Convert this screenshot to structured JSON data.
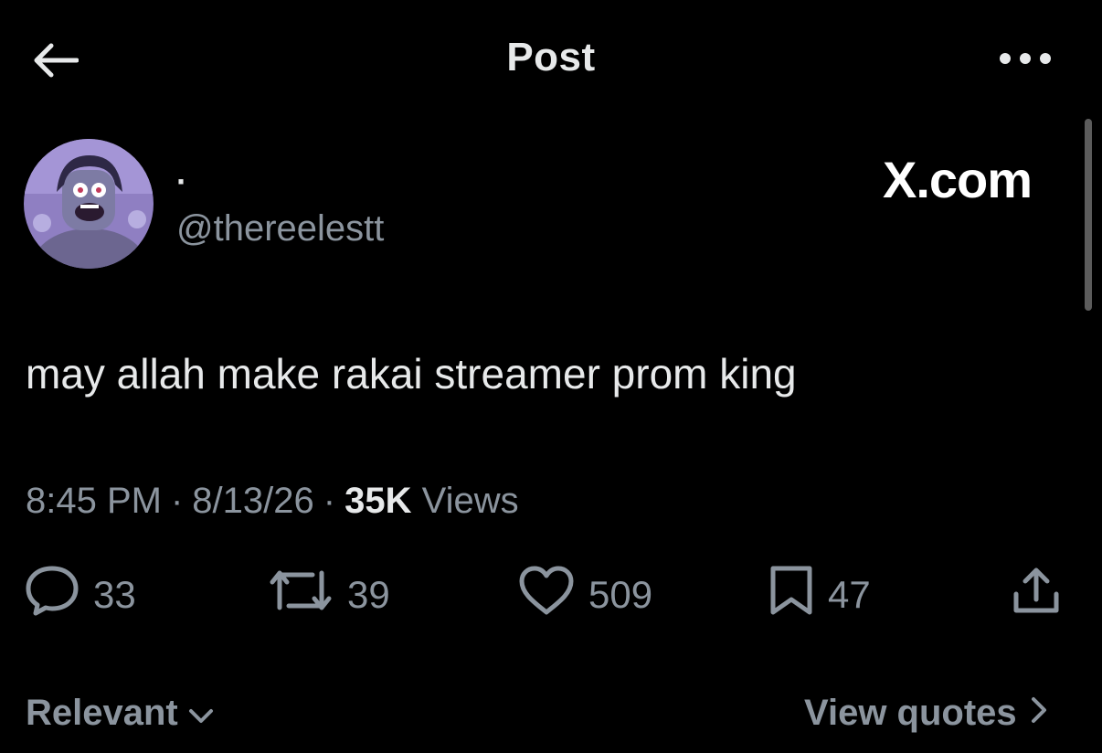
{
  "header": {
    "title": "Post",
    "back_icon": "arrow-left-icon",
    "more_icon": "more-horizontal-icon"
  },
  "author": {
    "display_name": "·",
    "handle": "@thereelestt",
    "avatar_icon": "avatar-cartoon-icon"
  },
  "watermark": "X.com",
  "post": {
    "text": "may allah make rakai streamer prom king"
  },
  "meta": {
    "time": "8:45 PM",
    "separator": "·",
    "date": "8/13/26",
    "views_count": "35K",
    "views_label": "Views"
  },
  "actions": {
    "replies": "33",
    "reposts": "39",
    "likes": "509",
    "bookmarks": "47"
  },
  "footer": {
    "sort_label": "Relevant",
    "quotes_label": "View quotes"
  },
  "colors": {
    "background": "#000000",
    "primary_text": "#e7e9ea",
    "secondary_text": "#8b949e"
  }
}
